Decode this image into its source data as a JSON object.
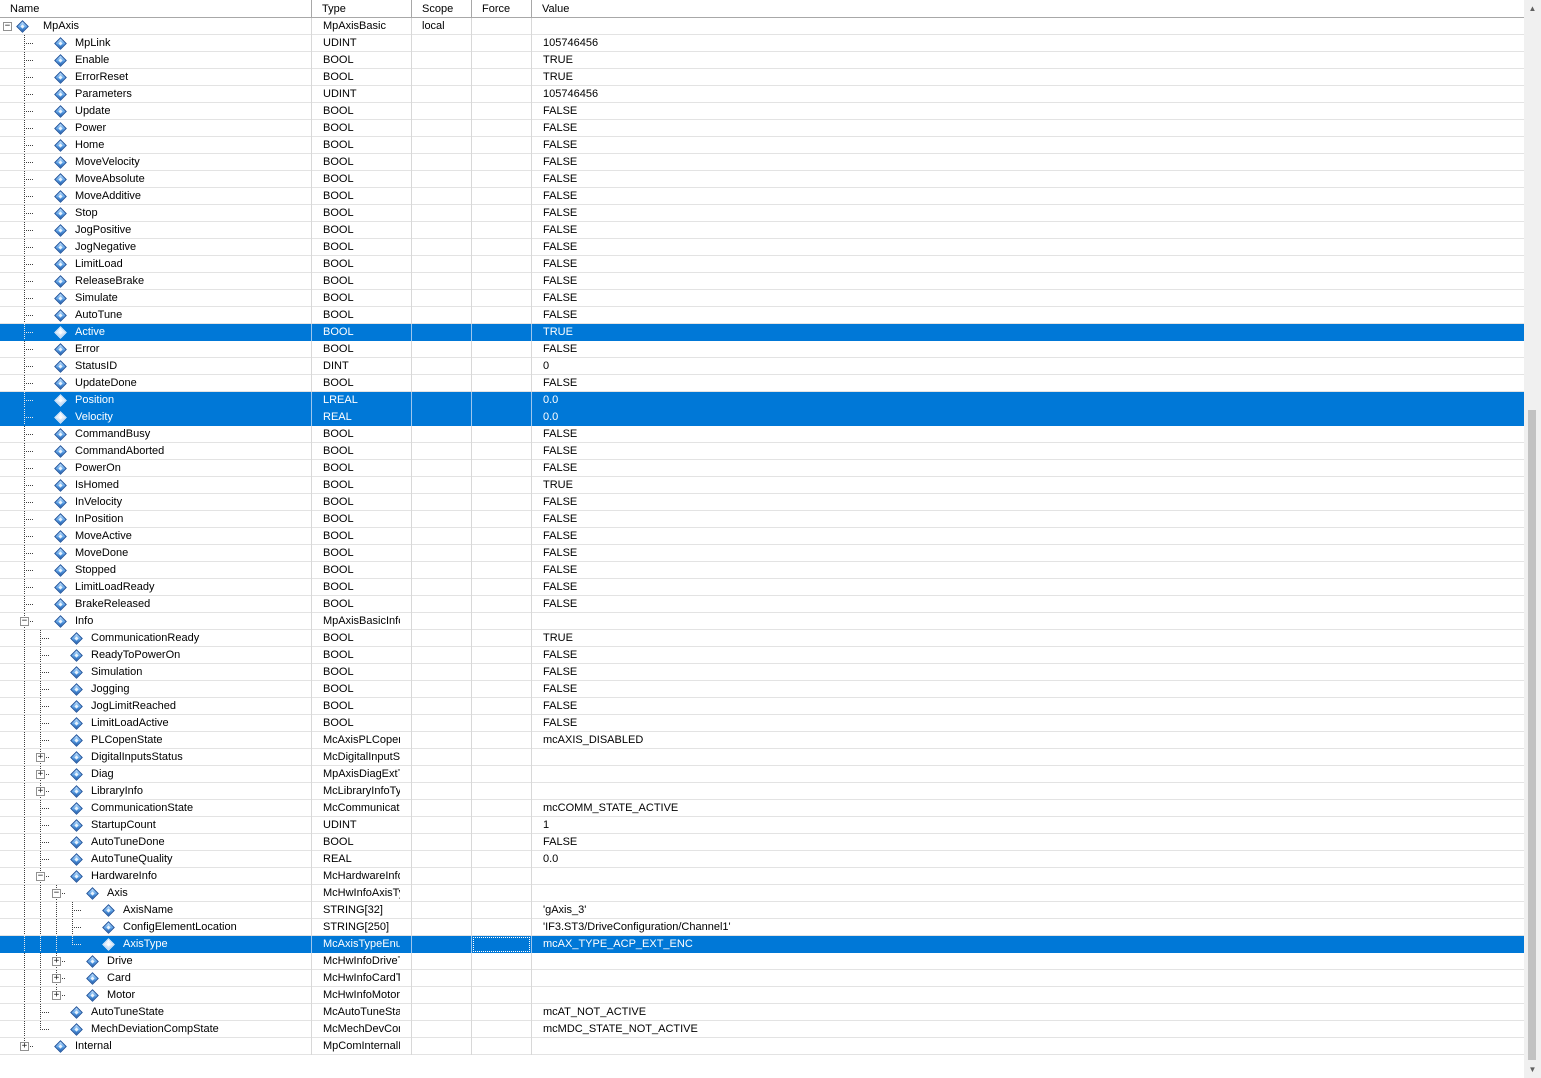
{
  "columns": {
    "name": "Name",
    "type": "Type",
    "scope": "Scope",
    "force": "Force",
    "value": "Value"
  },
  "colors": {
    "selection": "#0078d7",
    "icon_blue": "#3a86d8"
  },
  "icons": {
    "variable": "variable-diamond-icon",
    "expand": "plus-box-icon",
    "collapse": "minus-box-icon"
  },
  "rows": [
    {
      "name": "MpAxis",
      "type": "MpAxisBasic",
      "scope": "local",
      "value": "",
      "level": 0,
      "toggle": "collapse"
    },
    {
      "name": "MpLink",
      "type": "UDINT",
      "scope": "",
      "value": "105746456",
      "level": 1
    },
    {
      "name": "Enable",
      "type": "BOOL",
      "scope": "",
      "value": "TRUE",
      "level": 1
    },
    {
      "name": "ErrorReset",
      "type": "BOOL",
      "scope": "",
      "value": "TRUE",
      "level": 1
    },
    {
      "name": "Parameters",
      "type": "UDINT",
      "scope": "",
      "value": "105746456",
      "level": 1
    },
    {
      "name": "Update",
      "type": "BOOL",
      "scope": "",
      "value": "FALSE",
      "level": 1
    },
    {
      "name": "Power",
      "type": "BOOL",
      "scope": "",
      "value": "FALSE",
      "level": 1
    },
    {
      "name": "Home",
      "type": "BOOL",
      "scope": "",
      "value": "FALSE",
      "level": 1
    },
    {
      "name": "MoveVelocity",
      "type": "BOOL",
      "scope": "",
      "value": "FALSE",
      "level": 1
    },
    {
      "name": "MoveAbsolute",
      "type": "BOOL",
      "scope": "",
      "value": "FALSE",
      "level": 1
    },
    {
      "name": "MoveAdditive",
      "type": "BOOL",
      "scope": "",
      "value": "FALSE",
      "level": 1
    },
    {
      "name": "Stop",
      "type": "BOOL",
      "scope": "",
      "value": "FALSE",
      "level": 1
    },
    {
      "name": "JogPositive",
      "type": "BOOL",
      "scope": "",
      "value": "FALSE",
      "level": 1
    },
    {
      "name": "JogNegative",
      "type": "BOOL",
      "scope": "",
      "value": "FALSE",
      "level": 1
    },
    {
      "name": "LimitLoad",
      "type": "BOOL",
      "scope": "",
      "value": "FALSE",
      "level": 1
    },
    {
      "name": "ReleaseBrake",
      "type": "BOOL",
      "scope": "",
      "value": "FALSE",
      "level": 1
    },
    {
      "name": "Simulate",
      "type": "BOOL",
      "scope": "",
      "value": "FALSE",
      "level": 1
    },
    {
      "name": "AutoTune",
      "type": "BOOL",
      "scope": "",
      "value": "FALSE",
      "level": 1
    },
    {
      "name": "Active",
      "type": "BOOL",
      "scope": "",
      "value": "TRUE",
      "level": 1,
      "selected": true
    },
    {
      "name": "Error",
      "type": "BOOL",
      "scope": "",
      "value": "FALSE",
      "level": 1
    },
    {
      "name": "StatusID",
      "type": "DINT",
      "scope": "",
      "value": "0",
      "level": 1
    },
    {
      "name": "UpdateDone",
      "type": "BOOL",
      "scope": "",
      "value": "FALSE",
      "level": 1
    },
    {
      "name": "Position",
      "type": "LREAL",
      "scope": "",
      "value": "0.0",
      "level": 1,
      "selected": true
    },
    {
      "name": "Velocity",
      "type": "REAL",
      "scope": "",
      "value": "0.0",
      "level": 1,
      "selected": true
    },
    {
      "name": "CommandBusy",
      "type": "BOOL",
      "scope": "",
      "value": "FALSE",
      "level": 1
    },
    {
      "name": "CommandAborted",
      "type": "BOOL",
      "scope": "",
      "value": "FALSE",
      "level": 1
    },
    {
      "name": "PowerOn",
      "type": "BOOL",
      "scope": "",
      "value": "FALSE",
      "level": 1
    },
    {
      "name": "IsHomed",
      "type": "BOOL",
      "scope": "",
      "value": "TRUE",
      "level": 1
    },
    {
      "name": "InVelocity",
      "type": "BOOL",
      "scope": "",
      "value": "FALSE",
      "level": 1
    },
    {
      "name": "InPosition",
      "type": "BOOL",
      "scope": "",
      "value": "FALSE",
      "level": 1
    },
    {
      "name": "MoveActive",
      "type": "BOOL",
      "scope": "",
      "value": "FALSE",
      "level": 1
    },
    {
      "name": "MoveDone",
      "type": "BOOL",
      "scope": "",
      "value": "FALSE",
      "level": 1
    },
    {
      "name": "Stopped",
      "type": "BOOL",
      "scope": "",
      "value": "FALSE",
      "level": 1
    },
    {
      "name": "LimitLoadReady",
      "type": "BOOL",
      "scope": "",
      "value": "FALSE",
      "level": 1
    },
    {
      "name": "BrakeReleased",
      "type": "BOOL",
      "scope": "",
      "value": "FALSE",
      "level": 1
    },
    {
      "name": "Info",
      "type": "MpAxisBasicInfo",
      "scope": "",
      "value": "",
      "level": 1,
      "toggle": "collapse"
    },
    {
      "name": "CommunicationReady",
      "type": "BOOL",
      "scope": "",
      "value": "TRUE",
      "level": 2
    },
    {
      "name": "ReadyToPowerOn",
      "type": "BOOL",
      "scope": "",
      "value": "FALSE",
      "level": 2
    },
    {
      "name": "Simulation",
      "type": "BOOL",
      "scope": "",
      "value": "FALSE",
      "level": 2
    },
    {
      "name": "Jogging",
      "type": "BOOL",
      "scope": "",
      "value": "FALSE",
      "level": 2
    },
    {
      "name": "JogLimitReached",
      "type": "BOOL",
      "scope": "",
      "value": "FALSE",
      "level": 2
    },
    {
      "name": "LimitLoadActive",
      "type": "BOOL",
      "scope": "",
      "value": "FALSE",
      "level": 2
    },
    {
      "name": "PLCopenState",
      "type": "McAxisPLCopen",
      "scope": "",
      "value": "mcAXIS_DISABLED",
      "level": 2
    },
    {
      "name": "DigitalInputsStatus",
      "type": "McDigitalInputSt",
      "scope": "",
      "value": "",
      "level": 2,
      "toggle": "expand"
    },
    {
      "name": "Diag",
      "type": "MpAxisDiagExtT",
      "scope": "",
      "value": "",
      "level": 2,
      "toggle": "expand"
    },
    {
      "name": "LibraryInfo",
      "type": "McLibraryInfoTy",
      "scope": "",
      "value": "",
      "level": 2,
      "toggle": "expand"
    },
    {
      "name": "CommunicationState",
      "type": "McCommunicatic",
      "scope": "",
      "value": "mcCOMM_STATE_ACTIVE",
      "level": 2
    },
    {
      "name": "StartupCount",
      "type": "UDINT",
      "scope": "",
      "value": "1",
      "level": 2
    },
    {
      "name": "AutoTuneDone",
      "type": "BOOL",
      "scope": "",
      "value": "FALSE",
      "level": 2
    },
    {
      "name": "AutoTuneQuality",
      "type": "REAL",
      "scope": "",
      "value": "0.0",
      "level": 2
    },
    {
      "name": "HardwareInfo",
      "type": "McHardwareInfo",
      "scope": "",
      "value": "",
      "level": 2,
      "toggle": "collapse"
    },
    {
      "name": "Axis",
      "type": "McHwInfoAxisTy",
      "scope": "",
      "value": "",
      "level": 3,
      "toggle": "collapse"
    },
    {
      "name": "AxisName",
      "type": "STRING[32]",
      "scope": "",
      "value": "'gAxis_3'",
      "level": 4
    },
    {
      "name": "ConfigElementLocation",
      "type": "STRING[250]",
      "scope": "",
      "value": "'IF3.ST3/DriveConfiguration/Channel1'",
      "level": 4
    },
    {
      "name": "AxisType",
      "type": "McAxisTypeEnu",
      "scope": "",
      "value": "mcAX_TYPE_ACP_EXT_ENC",
      "level": 4,
      "selected": true,
      "last": true,
      "forceFocus": true
    },
    {
      "name": "Drive",
      "type": "McHwInfoDriveT",
      "scope": "",
      "value": "",
      "level": 3,
      "toggle": "expand"
    },
    {
      "name": "Card",
      "type": "McHwInfoCardT",
      "scope": "",
      "value": "",
      "level": 3,
      "toggle": "expand"
    },
    {
      "name": "Motor",
      "type": "McHwInfoMotor",
      "scope": "",
      "value": "",
      "level": 3,
      "toggle": "expand",
      "last": true
    },
    {
      "name": "AutoTuneState",
      "type": "McAutoTuneSta",
      "scope": "",
      "value": "mcAT_NOT_ACTIVE",
      "level": 2
    },
    {
      "name": "MechDeviationCompState",
      "type": "McMechDevCor",
      "scope": "",
      "value": "mcMDC_STATE_NOT_ACTIVE",
      "level": 2,
      "last": true
    },
    {
      "name": "Internal",
      "type": "MpComInternalD",
      "scope": "",
      "value": "",
      "level": 1,
      "toggle": "expand",
      "last": true
    }
  ]
}
